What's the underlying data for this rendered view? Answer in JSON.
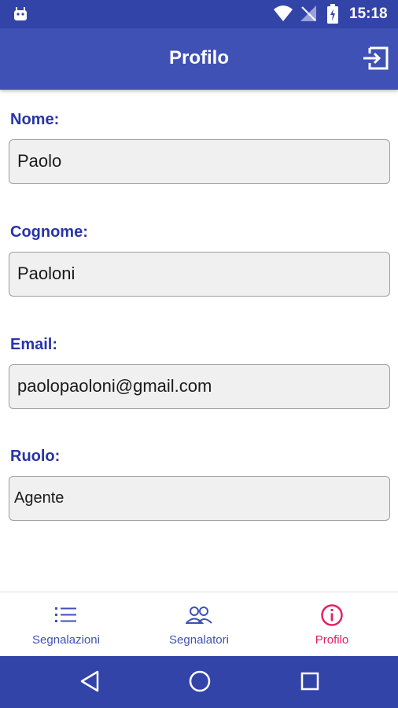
{
  "status_bar": {
    "time": "15:18",
    "icons": [
      "android-icon",
      "wifi-icon",
      "signal-icon",
      "battery-icon"
    ]
  },
  "app_bar": {
    "title": "Profilo",
    "action_icon": "logout-icon"
  },
  "form": {
    "nome": {
      "label": "Nome:",
      "value": "Paolo"
    },
    "cognome": {
      "label": "Cognome:",
      "value": "Paoloni"
    },
    "email": {
      "label": "Email:",
      "value": "paolopaoloni@gmail.com"
    },
    "ruolo": {
      "label": "Ruolo:",
      "value": "Agente"
    }
  },
  "bottom_nav": {
    "items": [
      {
        "label": "Segnalazioni",
        "icon": "list-icon",
        "active": false
      },
      {
        "label": "Segnalatori",
        "icon": "people-icon",
        "active": false
      },
      {
        "label": "Profilo",
        "icon": "info-icon",
        "active": true
      }
    ],
    "active_color": "#e91e63",
    "inactive_color": "#3f51b5"
  },
  "colors": {
    "primary": "#3f51b5",
    "primary_dark": "#3344a8",
    "label": "#2834a8",
    "accent": "#e91e63"
  },
  "system_nav": [
    "back-icon",
    "home-icon",
    "recents-icon"
  ]
}
